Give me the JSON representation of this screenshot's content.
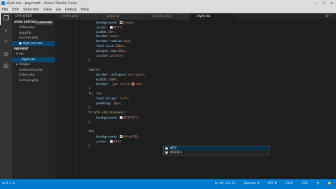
{
  "window": {
    "title": "style.css - payment - Visual Studio Code",
    "minimize": "—",
    "maximize": "☐",
    "close": "✕"
  },
  "menu": [
    "File",
    "Edit",
    "Selection",
    "View",
    "Go",
    "Debug",
    "Help"
  ],
  "activity": {
    "explorer": "❐",
    "search": "⌕",
    "scm": "⑂",
    "debug": "⊘",
    "extensions": "⊞"
  },
  "sidebar": {
    "title": "EXPLORER",
    "open_editors": {
      "label": "OPEN EDITORS",
      "badge": "1 UNSAVED",
      "items": [
        "index.php",
        "pay.php",
        "success.php",
        "● style.css  css"
      ]
    },
    "project": {
      "label": "PAYMENT",
      "folder_css": "css",
      "css_children": [
        "style.css"
      ],
      "folder_images": "images",
      "files": [
        "customers.php",
        "index.php",
        "success.php"
      ]
    }
  },
  "tabs": [
    "index.php",
    "pay.php",
    "success.php",
    "style.css"
  ],
  "tab_actions": "⊟ ⋯",
  "code": {
    "l1_prop": "background:",
    "l1_val": "green;",
    "l2_prop": "color:",
    "l2_val": "#FFF;",
    "l3_prop": "width:",
    "l3_val": "50%;",
    "l4_prop": "border:",
    "l4_val": "none;",
    "l5_prop": "border-radius:",
    "l5_val": "8px;",
    "l6_prop": "font-size:",
    "l6_val": "20px;",
    "l7_prop": "margin-top:",
    "l7_val": "20px;",
    "l8_prop": "cursor:",
    "l8_val": "pointer;",
    "l9": "}",
    "l10": "",
    "l11_sel": "table",
    "l11_p": "{",
    "l12_prop": "border-collapse:",
    "l12_val": "collapse;",
    "l13_prop": "width:",
    "l13_val": "100%;",
    "l14_prop": "border:",
    "l14_val": "1px solid ",
    "l14_val2": "red;",
    "l15": "}",
    "l16_sel": "th, td",
    "l16_p": "{",
    "l17_prop": "text-align:",
    "l17_val": "left;",
    "l18_prop": "padding:",
    "l18_val": "8px;",
    "l19": "}",
    "l20_sel": "tr:nth-child(even)",
    "l20_p": "{",
    "l21_prop": "background:",
    "l21_val": "#F2F2F2;",
    "l22": "}",
    "l23": "",
    "l24_sel": "th",
    "l24_p": "{",
    "l25_prop": "background:",
    "l25_val": "#4caf50;",
    "l26_prop": "color:",
    "l26_val": "#fff",
    "l27": "}"
  },
  "suggest": [
    "#FFF",
    "#F6F6F6"
  ],
  "colors": {
    "green": "#008000",
    "white": "#ffffff",
    "red": "#ff0000",
    "f2": "#f2f2f2",
    "lgreen": "#4caf50"
  },
  "status": {
    "left_icons": "⊗ 0  ⚠ 0",
    "position": "Ln 45, Col 15",
    "spaces": "Spaces: 4",
    "encoding": "UTF-8",
    "eol": "CRLF",
    "language": "CSS",
    "smiley": "☺",
    "bell": "🔔"
  }
}
